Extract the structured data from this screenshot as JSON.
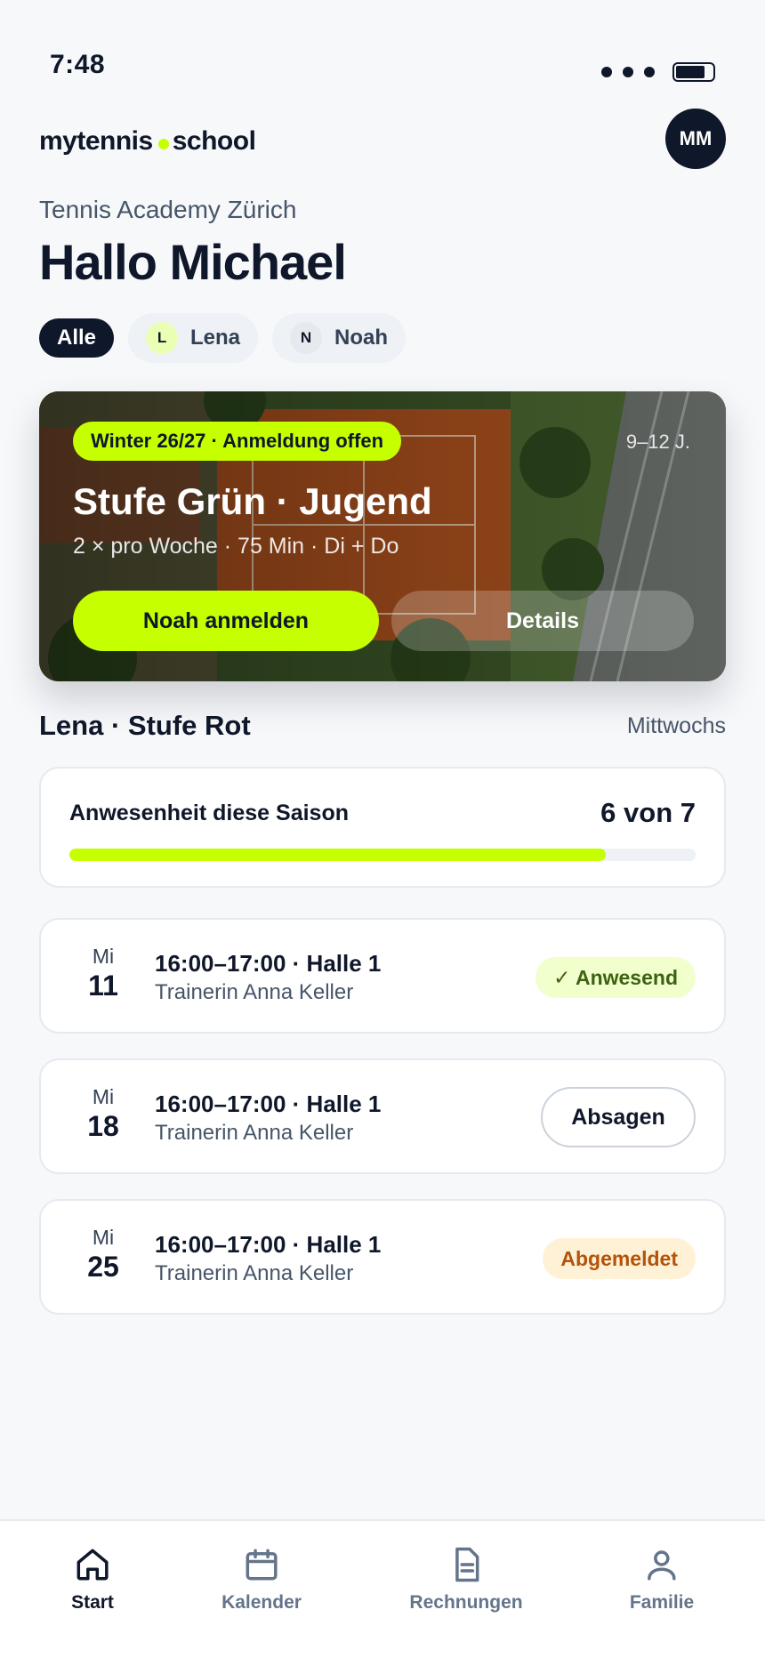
{
  "status_bar": {
    "time": "7:48"
  },
  "brand": {
    "left": "mytennis",
    "right": "school"
  },
  "avatar": {
    "initials": "MM"
  },
  "header": {
    "academy": "Tennis Academy Zürich",
    "greeting": "Hallo Michael"
  },
  "filters": [
    {
      "label": "Alle",
      "active": true
    },
    {
      "initial": "L",
      "label": "Lena",
      "active": false
    },
    {
      "initial": "N",
      "label": "Noah",
      "active": false
    }
  ],
  "hero": {
    "badge": "Winter 26/27 · Anmeldung offen",
    "age": "9–12 J.",
    "title": "Stufe Grün · Jugend",
    "subtitle": "2 × pro Woche · 75 Min · Di + Do",
    "primary_label": "Noah anmelden",
    "secondary_label": "Details"
  },
  "section": {
    "title": "Lena · Stufe Rot",
    "right": "Mittwochs"
  },
  "attendance": {
    "label": "Anwesenheit diese Saison",
    "value": "6 von 7",
    "progress": 0.857
  },
  "sessions": [
    {
      "day": "Mi",
      "date": "11",
      "time": "16:00–17:00 · Halle 1",
      "coach": "Trainerin Anna Keller",
      "status": "✓ Anwesend"
    },
    {
      "day": "Mi",
      "date": "18",
      "time": "16:00–17:00 · Halle 1",
      "coach": "Trainerin Anna Keller",
      "action": "Absagen"
    },
    {
      "day": "Mi",
      "date": "25",
      "time": "16:00–17:00 · Halle 1",
      "coach": "Trainerin Anna Keller",
      "status": "Abgemeldet"
    }
  ],
  "nav": [
    {
      "label": "Start",
      "icon": "home-icon",
      "active": true
    },
    {
      "label": "Kalender",
      "icon": "calendar-icon",
      "active": false
    },
    {
      "label": "Rechnungen",
      "icon": "document-icon",
      "active": false
    },
    {
      "label": "Familie",
      "icon": "person-icon",
      "active": false
    }
  ],
  "colors": {
    "accent": "#c5ff00",
    "ink": "#0f172a",
    "present": "#3f6212",
    "cancelled": "#b45309"
  }
}
